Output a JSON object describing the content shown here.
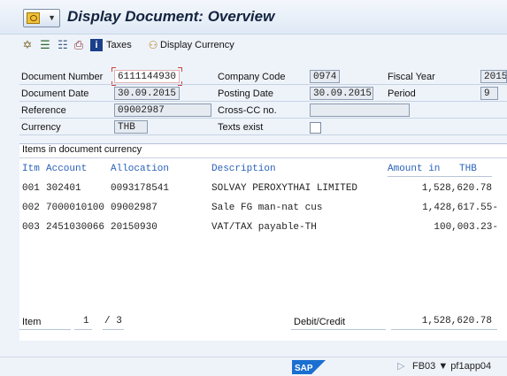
{
  "title": "Display Document: Overview",
  "toolbar": {
    "taxes_label": "Taxes",
    "display_currency_label": "Display Currency"
  },
  "header": {
    "doc_number_label": "Document Number",
    "doc_number": "6111144930",
    "company_code_label": "Company Code",
    "company_code": "0974",
    "fiscal_year_label": "Fiscal Year",
    "fiscal_year": "2015",
    "doc_date_label": "Document Date",
    "doc_date": "30.09.2015",
    "posting_date_label": "Posting Date",
    "posting_date": "30.09.2015",
    "period_label": "Period",
    "period": "9",
    "reference_label": "Reference",
    "reference": "09002987",
    "cross_cc_label": "Cross-CC no.",
    "cross_cc": "",
    "currency_label": "Currency",
    "currency": "THB",
    "texts_exist_label": "Texts exist"
  },
  "items": {
    "section_title": "Items in document currency",
    "col_itm": "Itm",
    "col_account": "Account",
    "col_allocation": "Allocation",
    "col_description": "Description",
    "col_amount": "Amount in",
    "col_currency": "THB",
    "rows": [
      {
        "itm": "001",
        "account": "302401",
        "allocation": "0093178541",
        "description": "SOLVAY PEROXYTHAI LIMITED",
        "amount": "1,528,620.78"
      },
      {
        "itm": "002",
        "account": "7000010100",
        "allocation": "09002987",
        "description": "Sale FG man-nat cus",
        "amount": "1,428,617.55-"
      },
      {
        "itm": "003",
        "account": "2451030066",
        "allocation": "20150930",
        "description": "VAT/TAX payable-TH",
        "amount": "100,003.23-"
      }
    ],
    "item_label": "Item",
    "item_current": "1",
    "item_total": "/ 3",
    "debit_credit_label": "Debit/Credit",
    "debit_credit_value": "1,528,620.78"
  },
  "status": {
    "logo_text": "SAP",
    "text": "FB03 ▼  pf1app04"
  }
}
